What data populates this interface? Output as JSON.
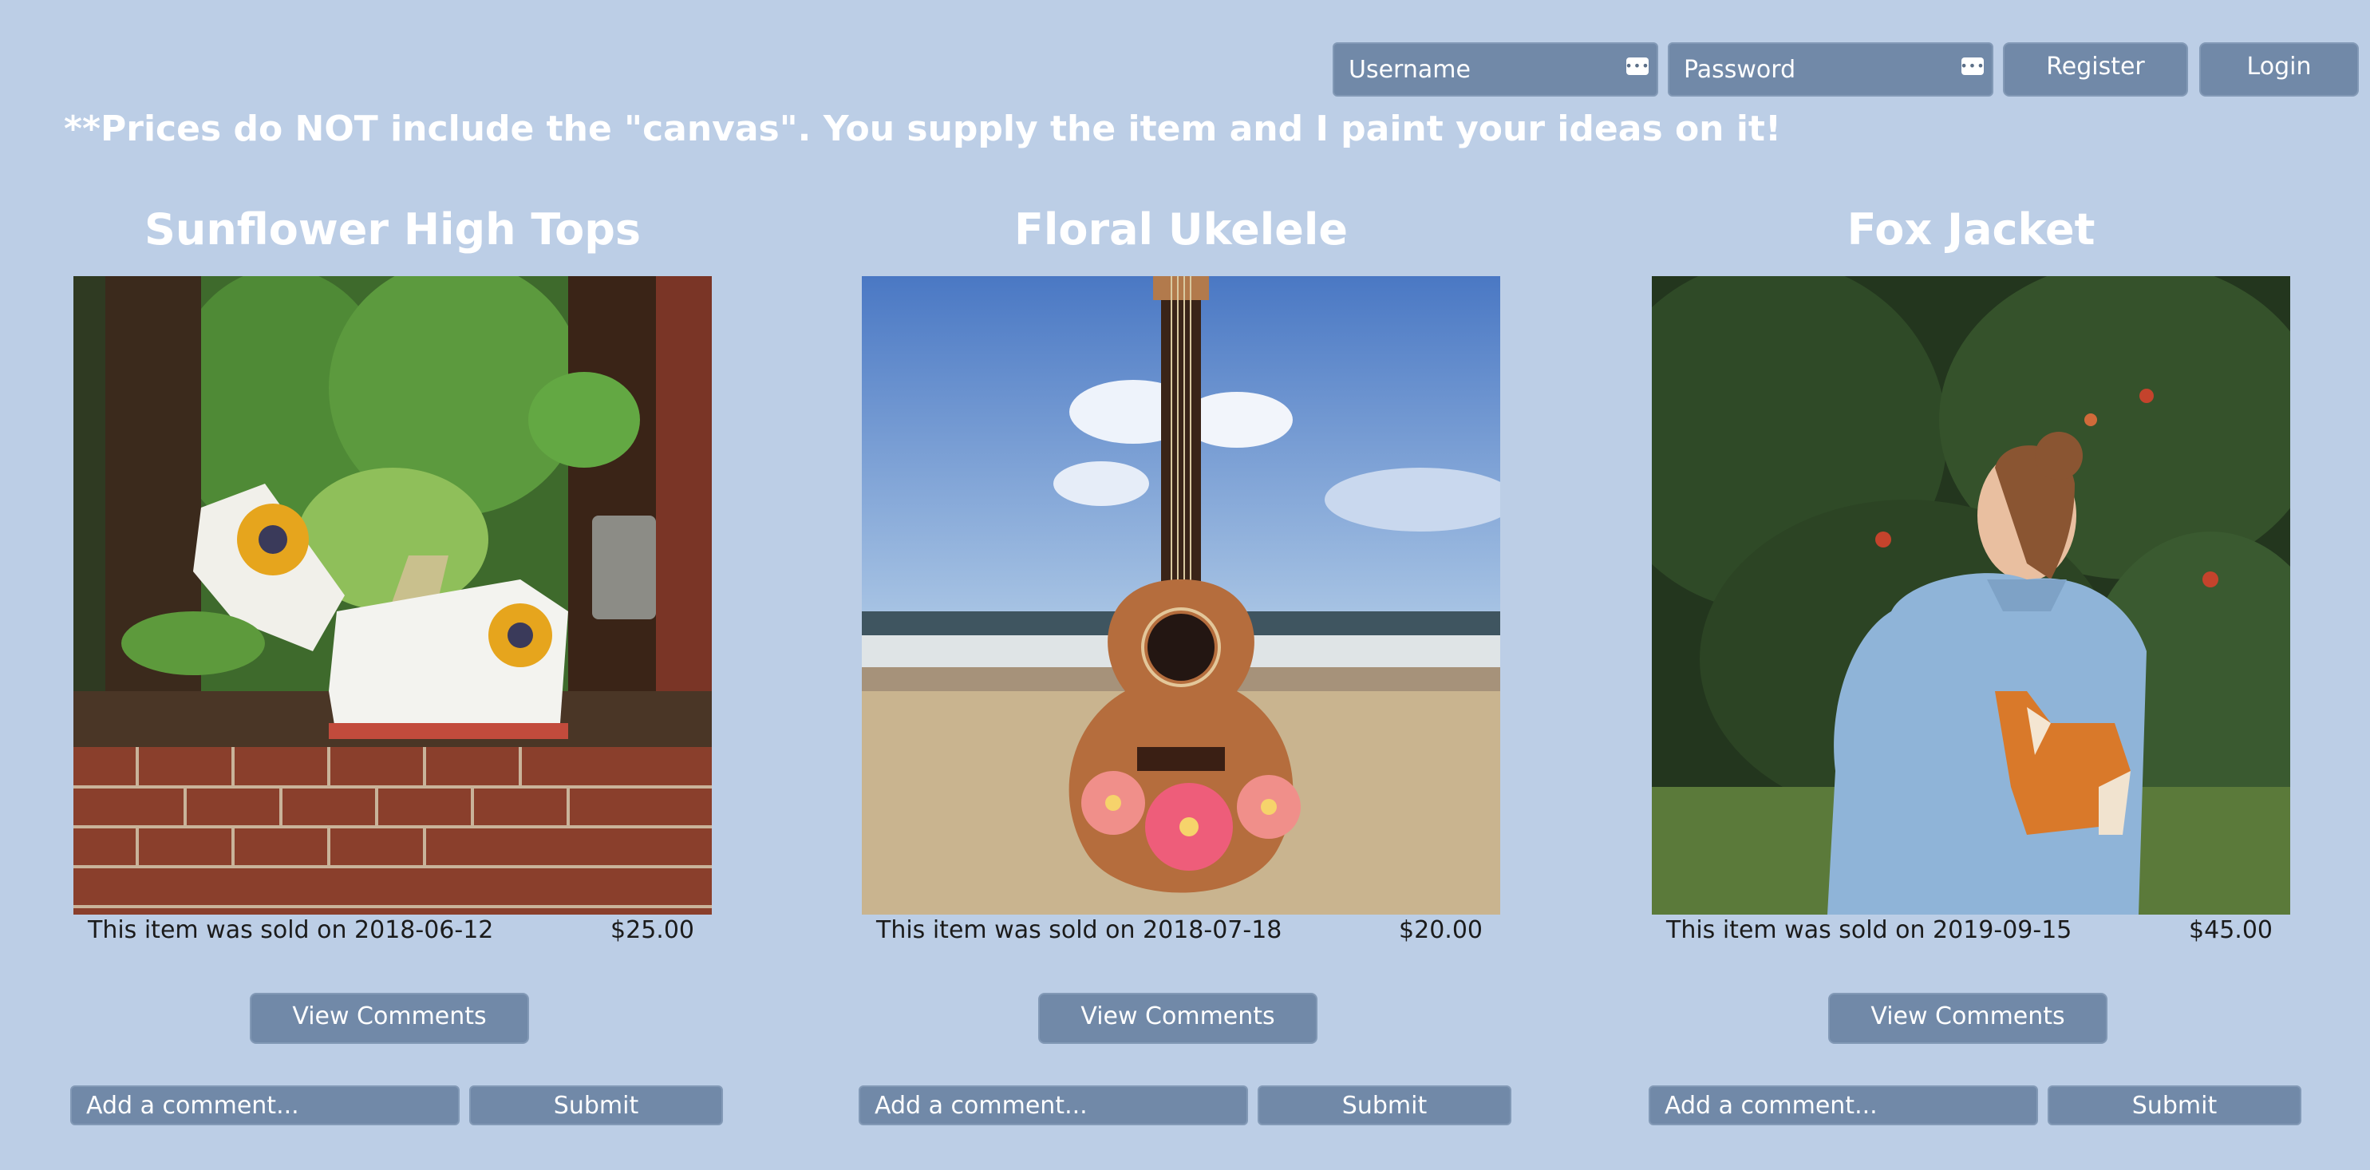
{
  "header": {
    "username_placeholder": "Username",
    "password_placeholder": "Password",
    "register_label": "Register",
    "login_label": "Login",
    "key_icon_glyph": "•••"
  },
  "notice": "**Prices do NOT include the \"canvas\". You supply the item and I paint your ideas on it!",
  "products": [
    {
      "title": "Sunflower High Tops",
      "sold_text": "This item was sold on 2018-06-12",
      "price": "$25.00",
      "view_comments_label": "View Comments",
      "comment_placeholder": "Add a comment...",
      "submit_label": "Submit"
    },
    {
      "title": "Floral Ukelele",
      "sold_text": "This item was sold on 2018-07-18",
      "price": "$20.00",
      "view_comments_label": "View Comments",
      "comment_placeholder": "Add a comment...",
      "submit_label": "Submit"
    },
    {
      "title": "Fox Jacket",
      "sold_text": "This item was sold on 2019-09-15",
      "price": "$45.00",
      "view_comments_label": "View Comments",
      "comment_placeholder": "Add a comment...",
      "submit_label": "Submit"
    }
  ],
  "colors": {
    "page_background": "#bccee6",
    "control_background": "#7189a8",
    "heading_text": "#ffffff"
  }
}
